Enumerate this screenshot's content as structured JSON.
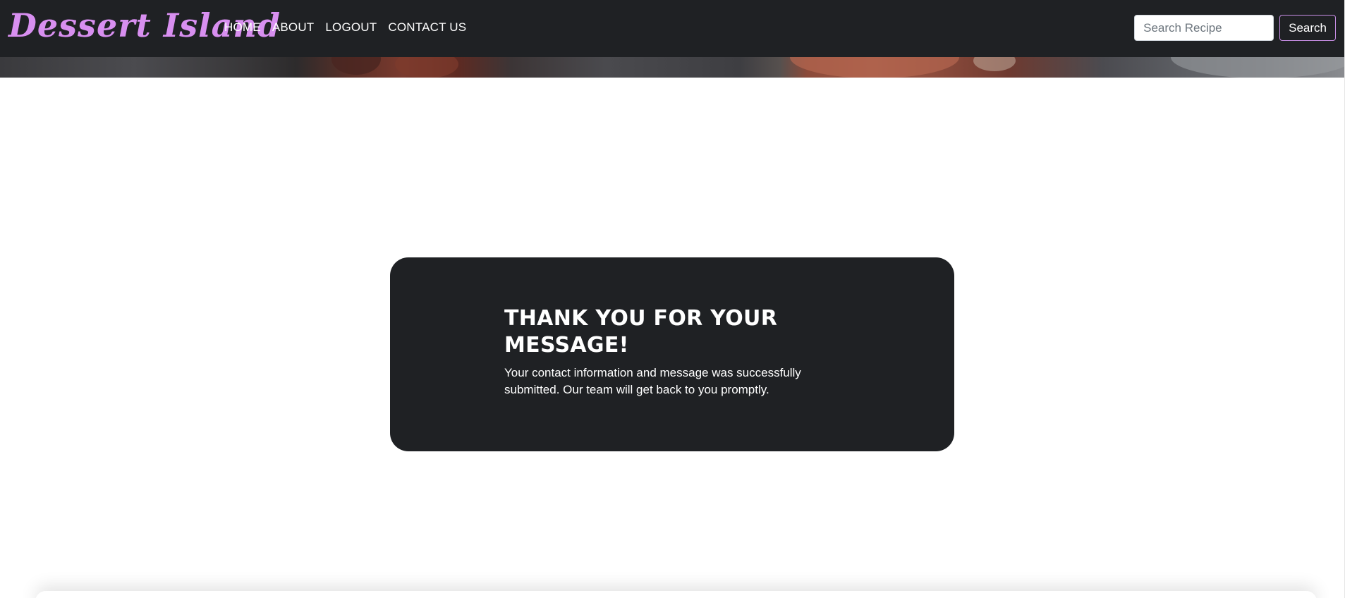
{
  "brand": {
    "name": "Dessert Island",
    "color": "#d88ff0"
  },
  "nav": {
    "items": [
      {
        "label": "HOME"
      },
      {
        "label": "ABOUT"
      },
      {
        "label": "LOGOUT"
      },
      {
        "label": "CONTACT US"
      }
    ]
  },
  "search": {
    "placeholder": "Search Recipe",
    "value": "",
    "button_label": "Search",
    "button_border_color": "#c98fe6"
  },
  "message": {
    "title": "THANK YOU FOR YOUR MESSAGE!",
    "text": "Your contact information and message was successfully submitted. Our team will get back to you promptly."
  },
  "colors": {
    "navbar_bg": "#1f2124",
    "card_bg": "#1f2124",
    "page_bg": "#ffffff"
  }
}
